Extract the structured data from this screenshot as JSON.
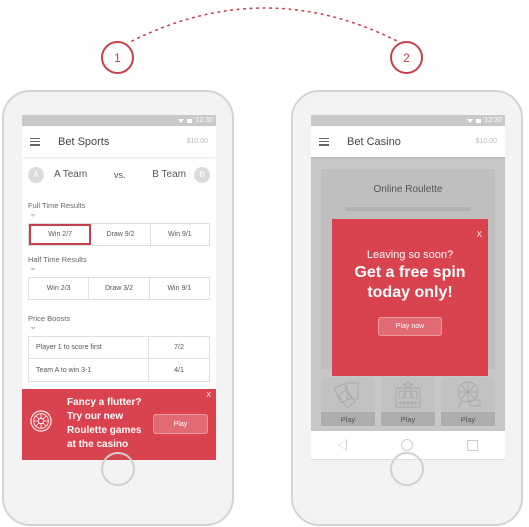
{
  "steps": [
    {
      "number": "1"
    },
    {
      "number": "2"
    }
  ],
  "colors": {
    "accent": "#d9434f",
    "step_outline": "#c4414e",
    "overlay": "#c8c8c8"
  },
  "phone1": {
    "status_time": "12:30",
    "app_title": "Bet Sports",
    "balance": "$10.00",
    "menu_icon": "hamburger-icon",
    "match": {
      "team_a_badge": "A",
      "team_a": "A Team",
      "vs": "vs.",
      "team_b": "B Team",
      "team_b_badge": "B"
    },
    "full_time": {
      "label": "Full Time Results",
      "odds": [
        "Win 2/7",
        "Draw 9/2",
        "Win 9/1"
      ],
      "selected_index": 0
    },
    "half_time": {
      "label": "Half Time Results",
      "odds": [
        "Win 2/3",
        "Draw 3/2",
        "Win 9/1"
      ]
    },
    "price_boosts": {
      "label": "Price Boosts",
      "rows": [
        {
          "name": "Player 1 to score first",
          "odds": "7/2"
        },
        {
          "name": "Team A to win 3-1",
          "odds": "4/1"
        }
      ]
    },
    "promo": {
      "icon": "roulette-wheel-icon",
      "lines": [
        "Fancy a flutter?",
        "Try our new",
        "Roulette games",
        "at the casino"
      ],
      "button": "Play",
      "close": "X"
    }
  },
  "phone2": {
    "status_time": "12:30",
    "app_title": "Bet Casino",
    "balance": "$10.00",
    "card_title": "Online Roulette",
    "games": [
      {
        "icon": "playing-cards-icon",
        "button": "Play"
      },
      {
        "icon": "slot-machine-icon",
        "button": "Play"
      },
      {
        "icon": "lottery-wheel-icon",
        "button": "Play"
      }
    ],
    "modal": {
      "close": "X",
      "subtitle": "Leaving so soon?",
      "headline_1": "Get a free spin",
      "headline_2": "today only!",
      "button": "Play now"
    },
    "nav": [
      "back-icon",
      "home-icon",
      "recent-apps-icon"
    ]
  }
}
